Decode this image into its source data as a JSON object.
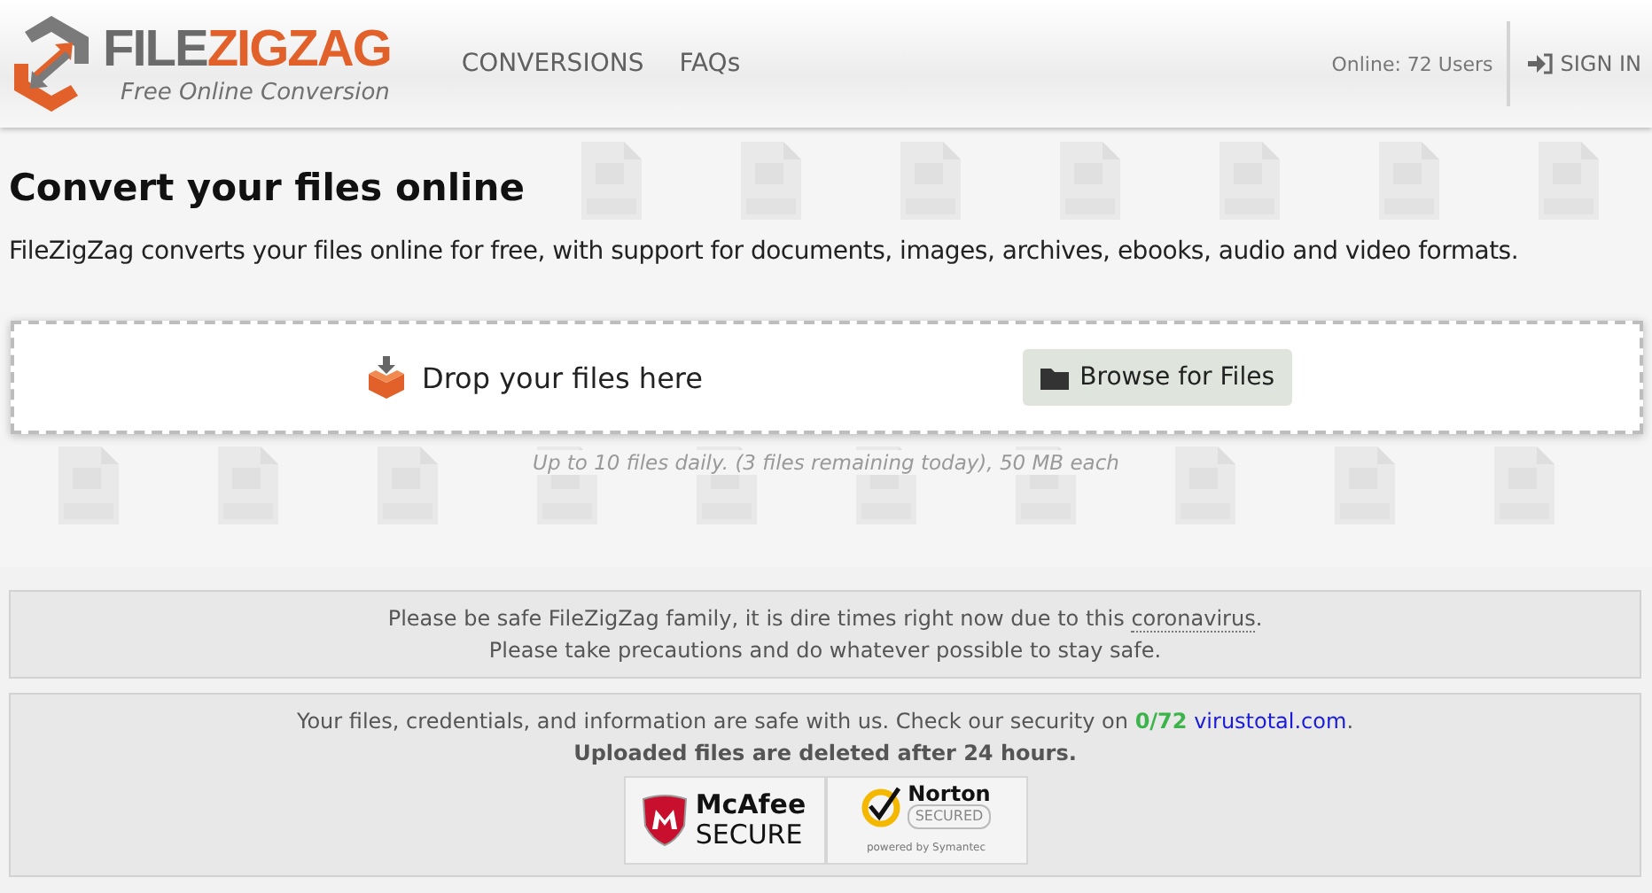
{
  "header": {
    "brand_first": "FILE",
    "brand_second": "ZIGZAG",
    "tagline": "Free Online Conversion",
    "nav": [
      {
        "label": "CONVERSIONS"
      },
      {
        "label": "FAQs"
      }
    ],
    "online": "Online: 72 Users",
    "sign_in": "SIGN IN"
  },
  "hero": {
    "title": "Convert your files online",
    "description": "FileZigZag converts your files online for free, with support for documents, images, archives, ebooks, audio and video formats.",
    "drop_label": "Drop your files here",
    "browse_button": "Browse for Files",
    "limits": "Up to 10 files daily. (3 files remaining today), 50 MB each"
  },
  "notices": [
    {
      "kind": "warning",
      "text_before": "Please be safe FileZigZag family, it is dire times right now due to this ",
      "link": "coronavirus",
      "text_after": ".",
      "second_line": "Please take precautions and do whatever possible to stay safe."
    },
    {
      "kind": "security",
      "text_before": "Your files, credentials, and information are safe with us. Check our security on ",
      "score": "0/72",
      "link": "virustotal.com",
      "text_after": ".",
      "second_line": "Uploaded files are deleted after 24 hours.",
      "badges": [
        {
          "kind": "mcafee",
          "name": "McAfee",
          "sub": "SECURE"
        },
        {
          "kind": "norton",
          "name": "Norton",
          "sub": "SECURED",
          "footer": "powered by Symantec"
        }
      ]
    }
  ]
}
